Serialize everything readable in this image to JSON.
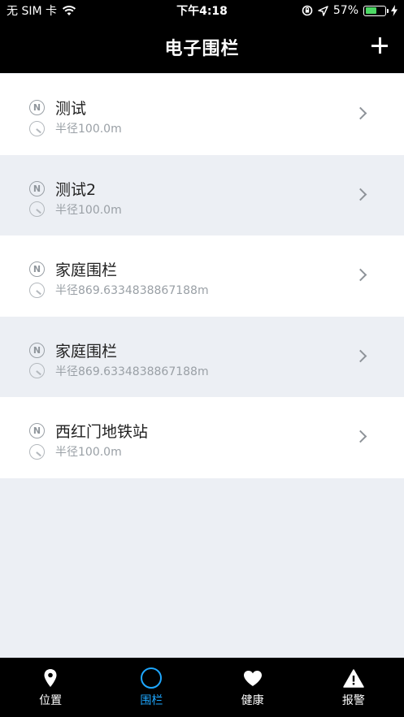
{
  "status": {
    "carrier": "无 SIM 卡",
    "time": "下午4:18",
    "battery": "57%",
    "battery_level": 0.57
  },
  "header": {
    "title": "电子围栏",
    "add_label": "+"
  },
  "fences": [
    {
      "name": "测试",
      "radius": "半径100.0m"
    },
    {
      "name": "测试2",
      "radius": "半径100.0m"
    },
    {
      "name": "家庭围栏",
      "radius": "半径869.6334838867188m"
    },
    {
      "name": "家庭围栏",
      "radius": "半径869.6334838867188m"
    },
    {
      "name": "西红门地铁站",
      "radius": "半径100.0m"
    }
  ],
  "tabs": [
    {
      "label": "位置",
      "icon": "location-pin-icon",
      "active": false
    },
    {
      "label": "围栏",
      "icon": "fence-ring-icon",
      "active": true
    },
    {
      "label": "健康",
      "icon": "heart-icon",
      "active": false
    },
    {
      "label": "报警",
      "icon": "warning-icon",
      "active": false
    }
  ],
  "colors": {
    "accent": "#1ea7ff",
    "bar_background": "#000000",
    "row_alt": "#eceff4",
    "battery_green": "#4cd964"
  }
}
